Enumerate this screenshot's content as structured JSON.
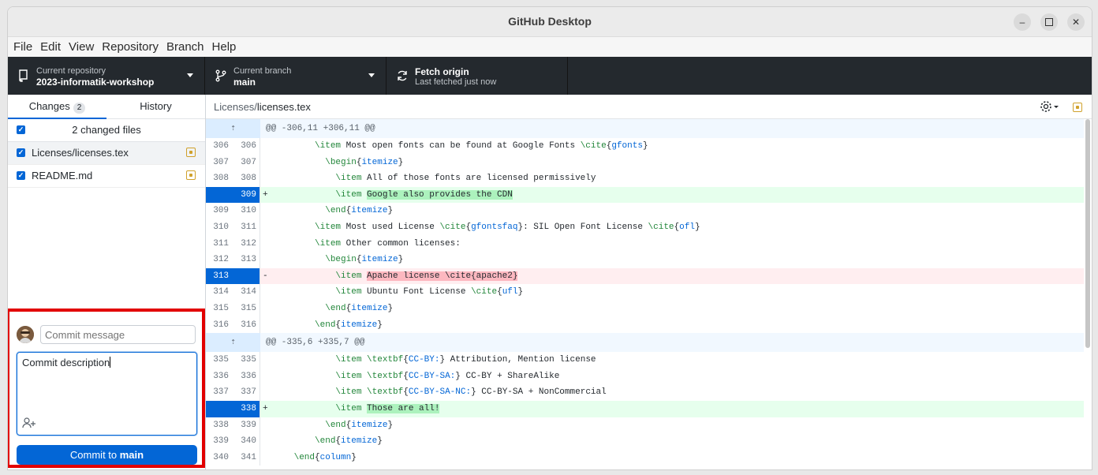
{
  "window": {
    "title": "GitHub Desktop"
  },
  "menu": [
    "File",
    "Edit",
    "View",
    "Repository",
    "Branch",
    "Help"
  ],
  "toolbar": {
    "repo": {
      "label": "Current repository",
      "value": "2023-informatik-workshop"
    },
    "branch": {
      "label": "Current branch",
      "value": "main"
    },
    "fetch": {
      "label": "Fetch origin",
      "value": "Last fetched just now"
    }
  },
  "sidebar": {
    "tabs": {
      "changes": "Changes",
      "changes_count": "2",
      "history": "History"
    },
    "changed_files": "2 changed files",
    "files": [
      {
        "name": "Licenses/licenses.tex"
      },
      {
        "name": "README.md"
      }
    ],
    "commit": {
      "summary_placeholder": "Commit message",
      "description_value": "Commit description",
      "button_prefix": "Commit to ",
      "button_branch": "main"
    }
  },
  "diff": {
    "path_dir": "Licenses/",
    "path_file": "licenses.tex",
    "hunk1": "@@ -306,11 +306,11 @@",
    "hunk2": "@@ -335,6 +335,7 @@",
    "lines1": [
      {
        "old": "306",
        "new": "306",
        "type": "ctx",
        "text": "        \\item Most open fonts can be found at Google Fonts \\cite{gfonts}"
      },
      {
        "old": "307",
        "new": "307",
        "type": "ctx",
        "text": "          \\begin{itemize}"
      },
      {
        "old": "308",
        "new": "308",
        "type": "ctx",
        "text": "            \\item All of those fonts are licensed permissively"
      },
      {
        "old": "",
        "new": "309",
        "type": "add",
        "text": "            \\item Google also provides the CDN"
      },
      {
        "old": "309",
        "new": "310",
        "type": "ctx",
        "text": "          \\end{itemize}"
      },
      {
        "old": "310",
        "new": "311",
        "type": "ctx",
        "text": "        \\item Most used License \\cite{gfontsfaq}: SIL Open Font License \\cite{ofl}"
      },
      {
        "old": "311",
        "new": "312",
        "type": "ctx",
        "text": "        \\item Other common licenses:"
      },
      {
        "old": "312",
        "new": "313",
        "type": "ctx",
        "text": "          \\begin{itemize}"
      },
      {
        "old": "313",
        "new": "",
        "type": "del",
        "text": "            \\item Apache license \\cite{apache2}"
      },
      {
        "old": "314",
        "new": "314",
        "type": "ctx",
        "text": "            \\item Ubuntu Font License \\cite{ufl}"
      },
      {
        "old": "315",
        "new": "315",
        "type": "ctx",
        "text": "          \\end{itemize}"
      },
      {
        "old": "316",
        "new": "316",
        "type": "ctx",
        "text": "        \\end{itemize}"
      }
    ],
    "lines2": [
      {
        "old": "335",
        "new": "335",
        "type": "ctx",
        "text": "            \\item \\textbf{CC-BY:} Attribution, Mention license"
      },
      {
        "old": "336",
        "new": "336",
        "type": "ctx",
        "text": "            \\item \\textbf{CC-BY-SA:} CC-BY + ShareAlike"
      },
      {
        "old": "337",
        "new": "337",
        "type": "ctx",
        "text": "            \\item \\textbf{CC-BY-SA-NC:} CC-BY-SA + NonCommercial"
      },
      {
        "old": "",
        "new": "338",
        "type": "add",
        "text": "            \\item Those are all!"
      },
      {
        "old": "338",
        "new": "339",
        "type": "ctx",
        "text": "          \\end{itemize}"
      },
      {
        "old": "339",
        "new": "340",
        "type": "ctx",
        "text": "        \\end{itemize}"
      },
      {
        "old": "340",
        "new": "341",
        "type": "ctx",
        "text": "    \\end{column}"
      }
    ]
  },
  "colors": {
    "accent": "#0366d6",
    "toolbar": "#24292e",
    "highlight_box": "#e20000"
  }
}
